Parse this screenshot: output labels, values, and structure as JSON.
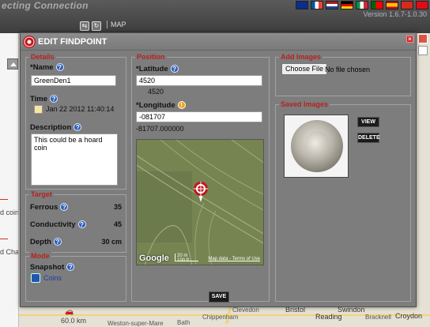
{
  "app": {
    "title": "ecting Connection",
    "version": "Version 1.6.7-1.0.30",
    "map_tab": "MAP",
    "left_labels": [
      "rd coin",
      "rd Chap"
    ],
    "distance": "60.0 km",
    "map_labels": [
      "Clevedon",
      "Bristol",
      "Chippenham",
      "Swindon",
      "Reading",
      "Bracknell",
      "Croydon",
      "Weston-super-Mare",
      "Bath"
    ],
    "flag_colors": [
      "#0b2d8c",
      "#c8102e",
      "#0055a4",
      "#ffffff",
      "#009246",
      "#c60b1e",
      "#d52b1e",
      "#006847",
      "#e30a17"
    ]
  },
  "modal": {
    "title": "EDIT FINDPOINT",
    "close_label": "×",
    "save_label": "SAVE",
    "details": {
      "section_title": "Details",
      "name_label": "*Name",
      "name_value": "GreenDen1",
      "time_label": "Time",
      "time_value": "Jan 22 2012 11:40:14",
      "description_label": "Description",
      "description_value": "This could be a hoard coin"
    },
    "position": {
      "section_title": "Position",
      "latitude_label": "*Latitude",
      "latitude_value": "4520",
      "latitude_decimal": "4520",
      "longitude_label": "*Longitude",
      "longitude_value": "-081707",
      "longitude_decimal": "-81707.000000",
      "map": {
        "brand": "Google",
        "scale_m": "20 m",
        "scale_ft": "100 ft",
        "terms": "Map data - Terms of Use"
      }
    },
    "target": {
      "section_title": "Target",
      "ferrous_label": "Ferrous",
      "ferrous_value": "35",
      "conductivity_label": "Conductivity",
      "conductivity_value": "45",
      "depth_label": "Depth",
      "depth_value": "30 cm"
    },
    "mode": {
      "section_title": "Mode",
      "snapshot_label": "Snapshot",
      "mode_value": "Coins"
    },
    "add_images": {
      "section_title": "Add Images",
      "choose_label": "Choose File",
      "no_file_label": "No file chosen"
    },
    "saved_images": {
      "section_title": "Saved Images",
      "view_label": "VIEW",
      "delete_label": "DELETE"
    }
  }
}
